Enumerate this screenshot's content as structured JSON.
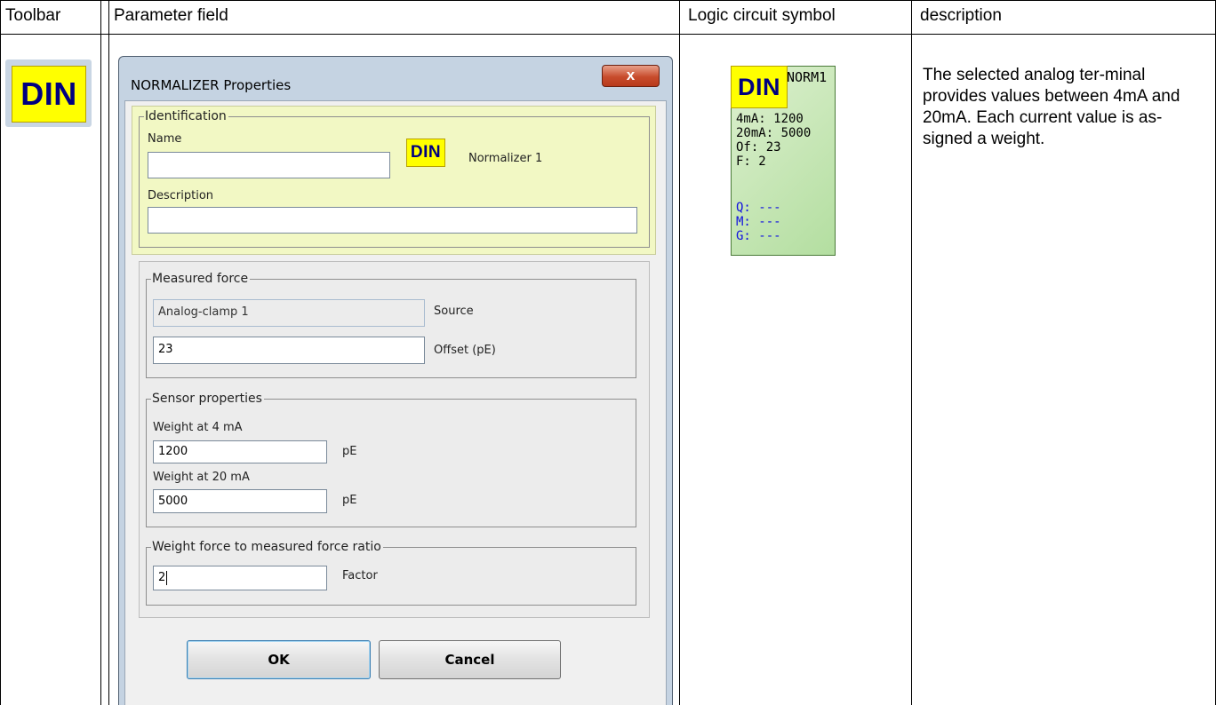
{
  "table": {
    "headers": [
      "Toolbar",
      "Parameter field",
      "Logic circuit symbol",
      "description"
    ]
  },
  "toolbar_icon": {
    "label": "DIN"
  },
  "dialog": {
    "title": "NORMALIZER Properties",
    "close_glyph": "x",
    "identification": {
      "legend": "Identification",
      "name_label": "Name",
      "name_value": "",
      "icon_label": "DIN",
      "element_name": "Normalizer 1",
      "description_label": "Description",
      "description_value": ""
    },
    "measured_force": {
      "legend": "Measured force",
      "source_value": "Analog-clamp  1",
      "source_label": "Source",
      "offset_value": "23",
      "offset_label": "Offset (pE)"
    },
    "sensor_properties": {
      "legend": "Sensor properties",
      "weight4_label": "Weight at 4 mA",
      "weight4_value": "1200",
      "weight4_unit": "pE",
      "weight20_label": "Weight at 20 mA",
      "weight20_value": "5000",
      "weight20_unit": "pE"
    },
    "ratio": {
      "legend": "Weight force to measured force ratio",
      "factor_value": "2",
      "factor_label": "Factor"
    },
    "ok_label": "OK",
    "cancel_label": "Cancel"
  },
  "symbol": {
    "badge": "DIN",
    "title": "NORM1",
    "lines": [
      "4mA: 1200",
      "20mA: 5000",
      "Of: 23",
      "F: 2"
    ],
    "outputs": [
      "Q: ---",
      "M: ---",
      "G: ---"
    ],
    "output_color": "#1010e0"
  },
  "description_text": "The selected analog ter-minal provides values between 4mA and 20mA. Each current value is as-signed a weight."
}
